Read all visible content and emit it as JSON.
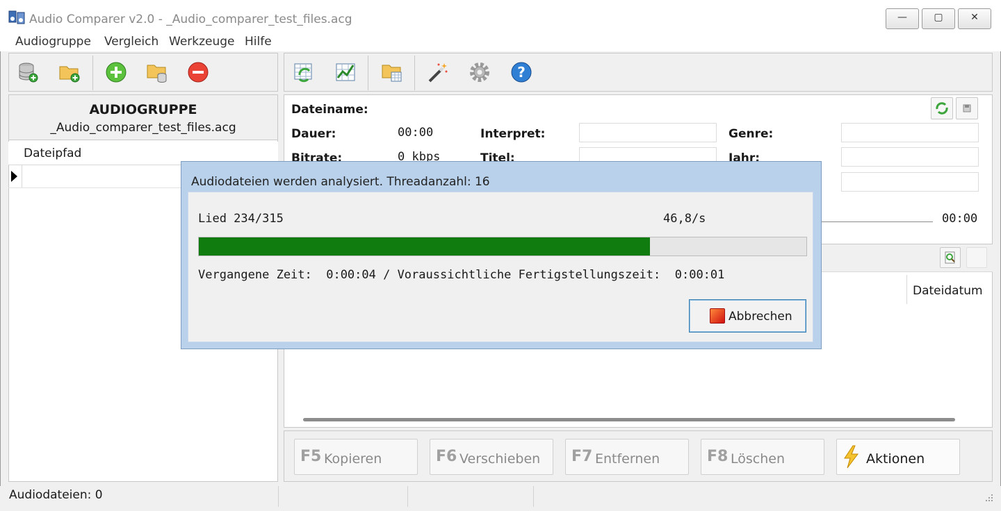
{
  "window": {
    "title": "Audio Comparer v2.0 - _Audio_comparer_test_files.acg",
    "controls": {
      "minimize": "—",
      "maximize": "▢",
      "close": "✕"
    }
  },
  "menu": [
    "Audiogruppe",
    "Vergleich",
    "Werkzeuge",
    "Hilfe"
  ],
  "left_toolbar_icons": [
    "database-add-icon",
    "folder-add-icon",
    "add-icon",
    "folder-database-icon",
    "remove-icon"
  ],
  "right_toolbar_icons": [
    "table-refresh-icon",
    "compare-icon",
    "folder-table-icon",
    "magic-wand-icon",
    "gear-icon",
    "help-icon"
  ],
  "group": {
    "title": "AUDIOGRUPPE",
    "file": "_Audio_comparer_test_files.acg",
    "column_header": "Dateipfad"
  },
  "details": {
    "dateiname_label": "Dateiname:",
    "dauer_label": "Dauer:",
    "dauer_value": "00:00",
    "bitrate_label": "Bitrate:",
    "bitrate_value": "0 kbps",
    "interpret_label": "Interpret:",
    "titel_label": "Titel:",
    "genre_label": "Genre:",
    "jahr_label": "Jahr:",
    "time_value": "00:00"
  },
  "list": {
    "column_dateidatum": "Dateidatum"
  },
  "actions": [
    {
      "key": "F5",
      "label": "Kopieren"
    },
    {
      "key": "F6",
      "label": "Verschieben"
    },
    {
      "key": "F7",
      "label": "Entfernen"
    },
    {
      "key": "F8",
      "label": "Löschen"
    }
  ],
  "aktionen_label": "Aktionen",
  "status": {
    "audiodateien": "Audiodateien: 0"
  },
  "dialog": {
    "title": "Audiodateien werden analysiert. Threadanzahl: 16",
    "song_progress": "Lied 234/315",
    "rate": "46,8/s",
    "progress_fraction": 0.743,
    "time_text": "Vergangene Zeit:  0:00:04 / Voraussichtliche Fertigstellungszeit:  0:00:01",
    "cancel_label": "Abbrechen"
  },
  "colors": {
    "progress": "#107c10",
    "dialog_frame": "#b9d1ea"
  }
}
